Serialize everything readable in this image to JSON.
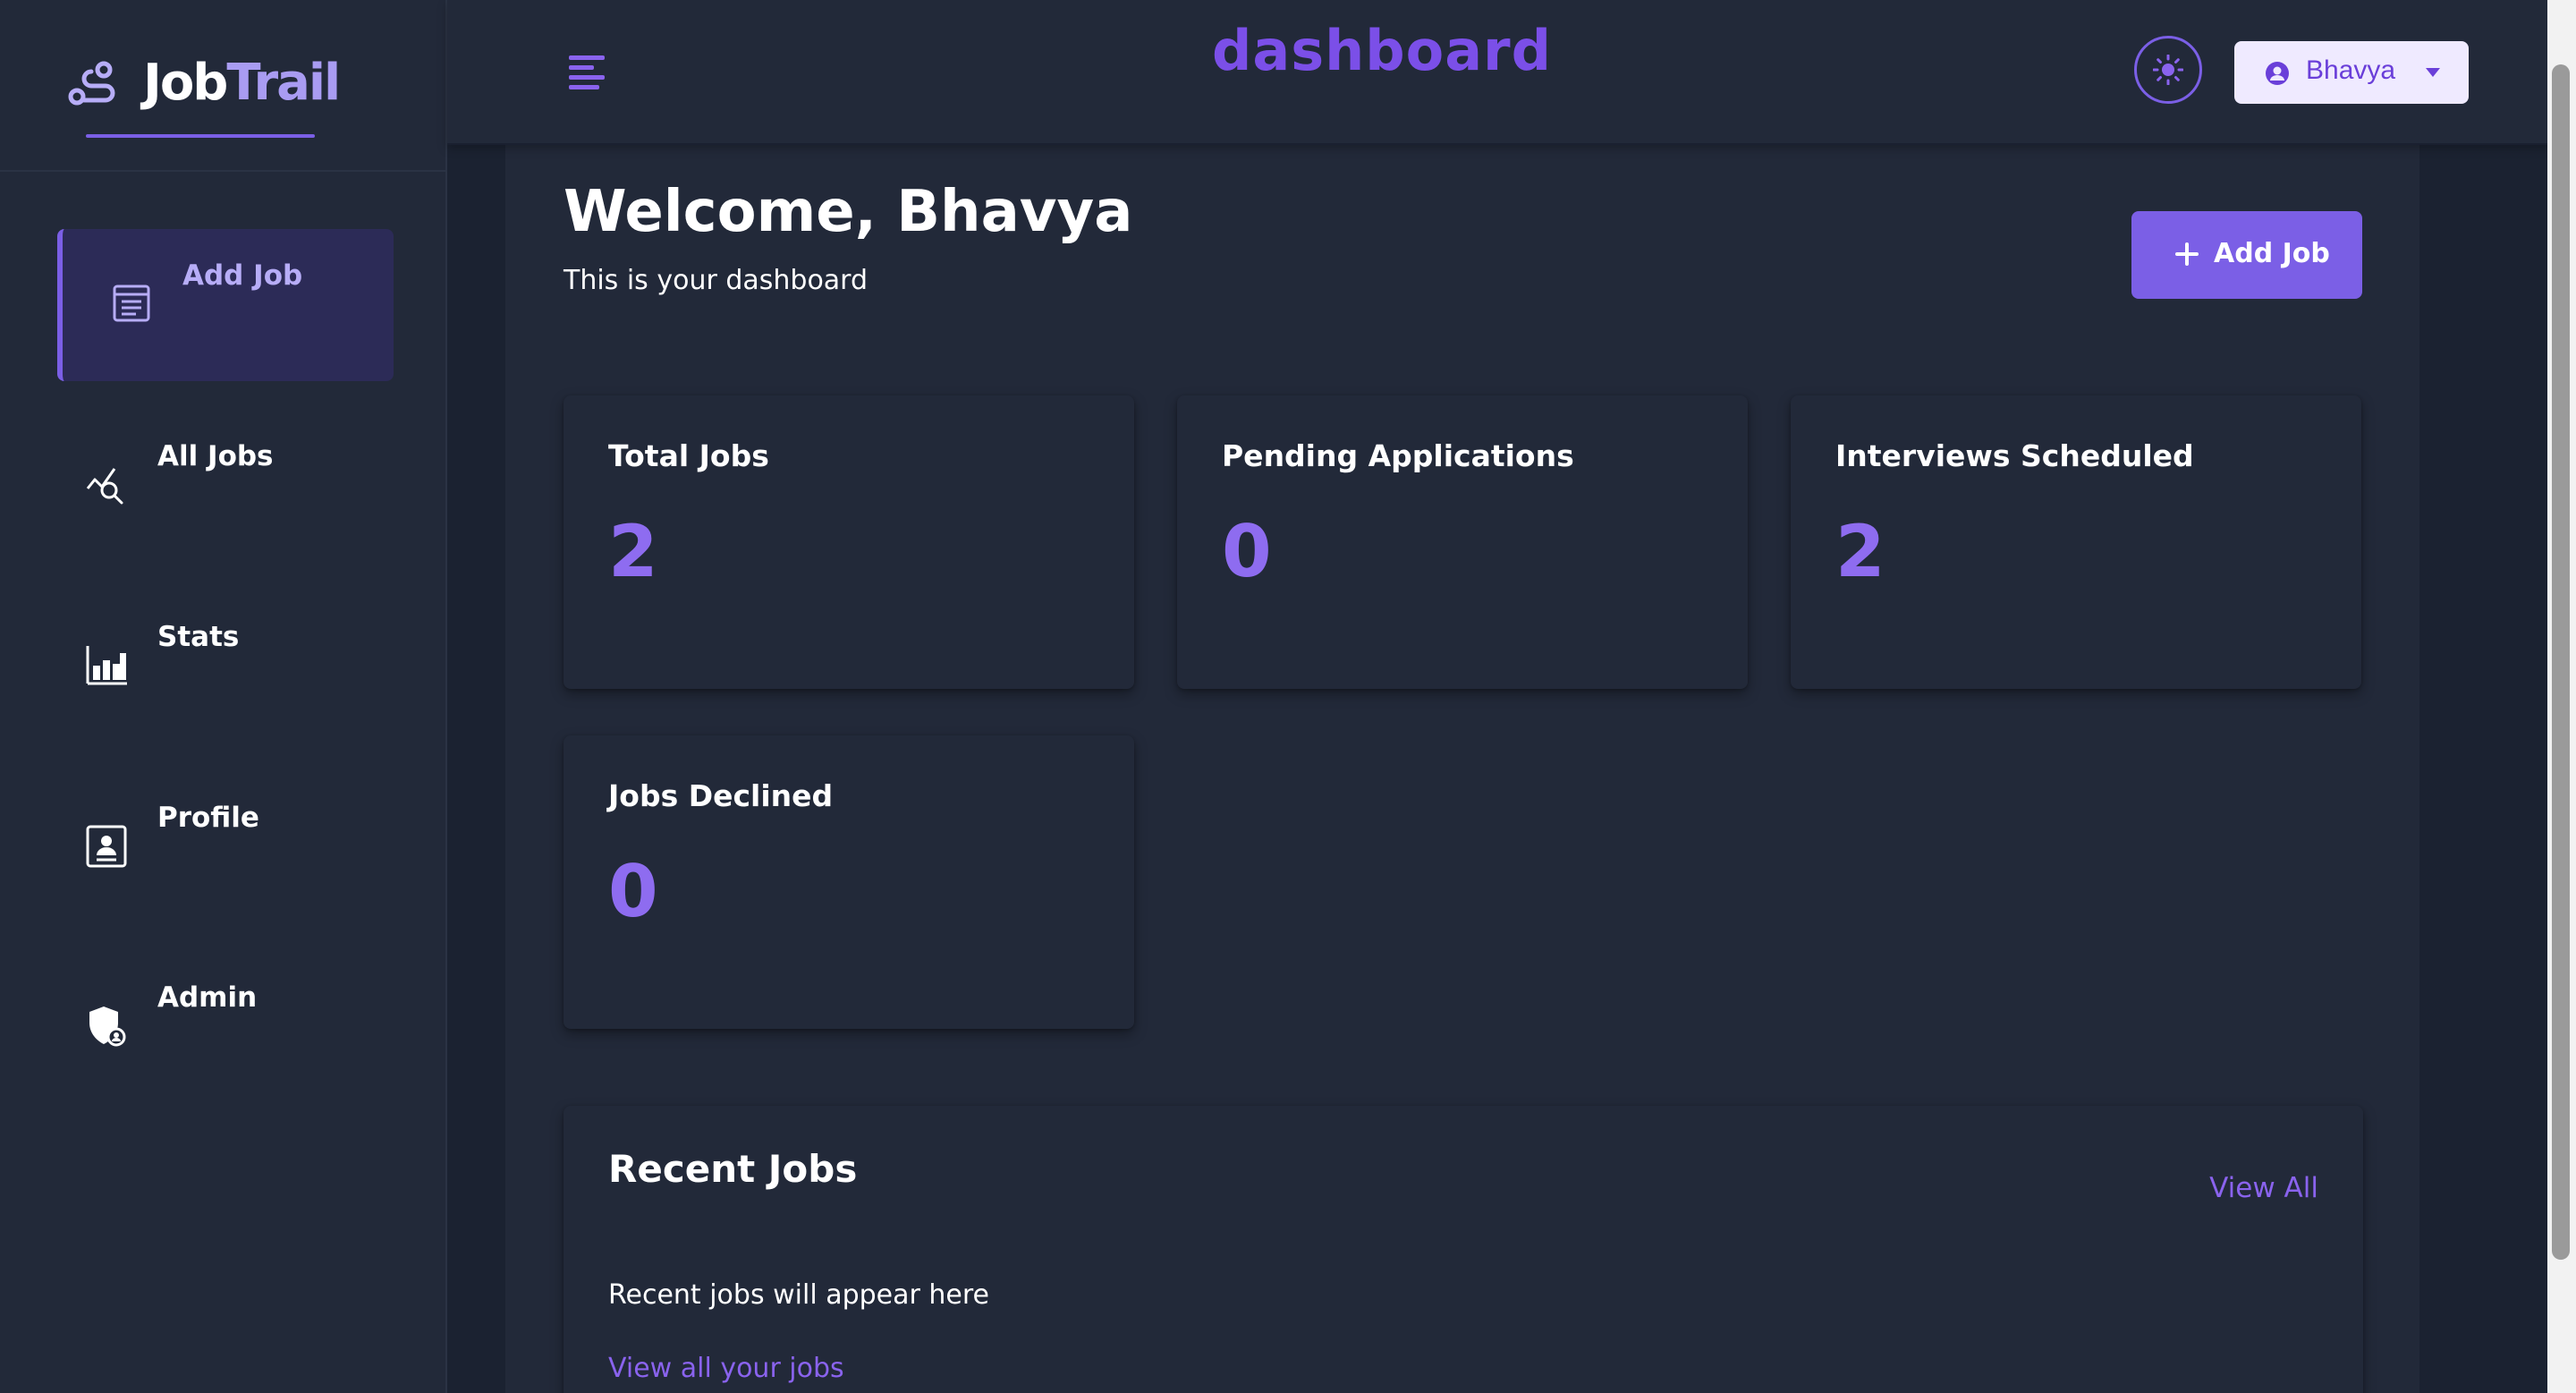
{
  "brand": {
    "name_part1": "Job",
    "name_part2": "Trail"
  },
  "topbar": {
    "title": "dashboard",
    "user_name": "Bhavya"
  },
  "sidebar": {
    "items": [
      {
        "label": "Add Job",
        "icon": "add-job-icon",
        "active": true
      },
      {
        "label": "All Jobs",
        "icon": "all-jobs-icon",
        "active": false
      },
      {
        "label": "Stats",
        "icon": "stats-icon",
        "active": false
      },
      {
        "label": "Profile",
        "icon": "profile-icon",
        "active": false
      },
      {
        "label": "Admin",
        "icon": "admin-icon",
        "active": false
      }
    ]
  },
  "main": {
    "welcome": "Welcome, Bhavya",
    "subtitle": "This is your dashboard",
    "add_job_label": "Add Job",
    "stats": [
      {
        "title": "Total Jobs",
        "value": "2"
      },
      {
        "title": "Pending Applications",
        "value": "0"
      },
      {
        "title": "Interviews Scheduled",
        "value": "2"
      },
      {
        "title": "Jobs Declined",
        "value": "0"
      }
    ],
    "recent": {
      "title": "Recent Jobs",
      "view_all": "View All",
      "empty_text": "Recent jobs will appear here",
      "link_text": "View all your jobs"
    }
  },
  "colors": {
    "accent": "#7b5fe6",
    "background": "#1b2231",
    "panel": "#222939",
    "title": "#7b4fe8"
  }
}
